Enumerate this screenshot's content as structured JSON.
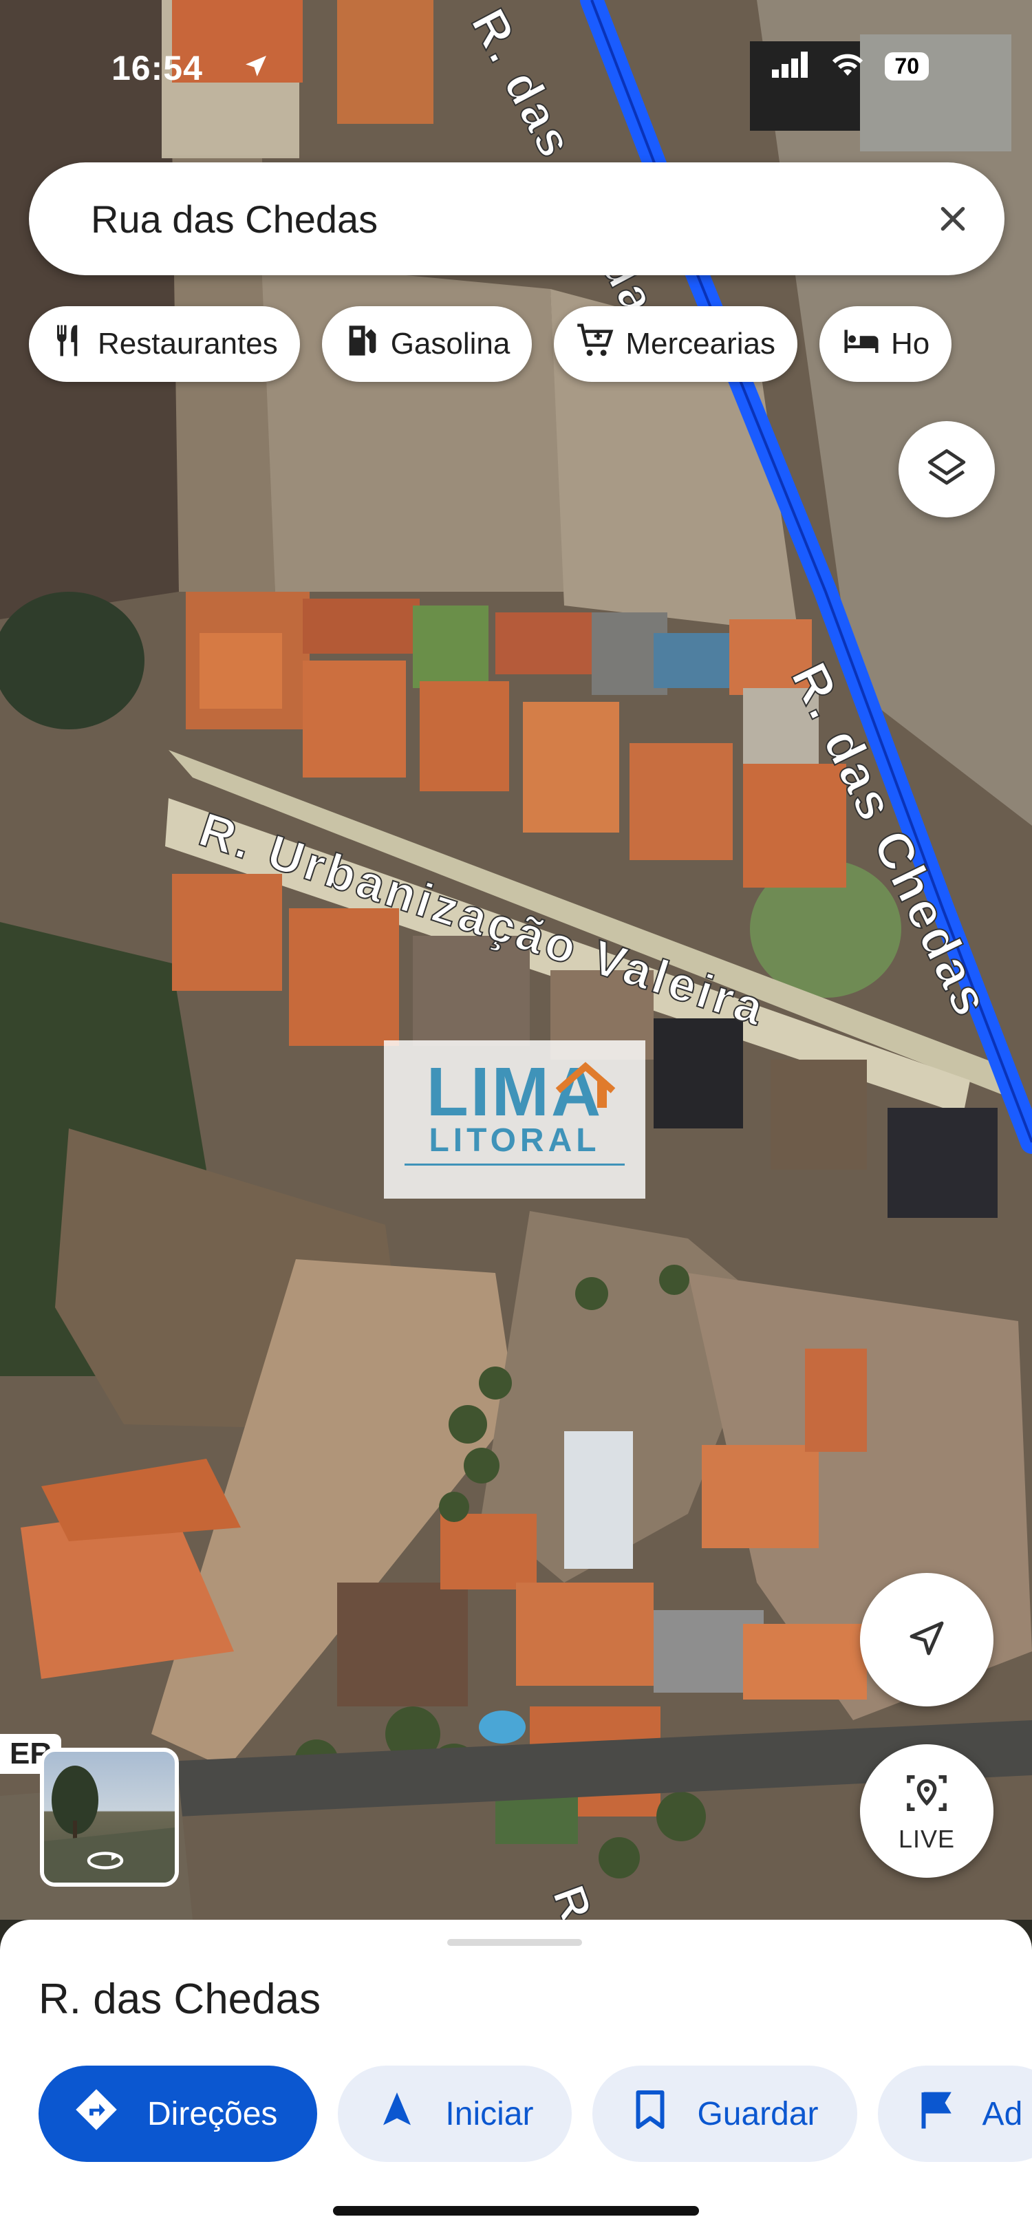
{
  "status_bar": {
    "time": "16:54",
    "battery": "70"
  },
  "search": {
    "value": "Rua das Chedas"
  },
  "chips": [
    {
      "label": "Restaurantes",
      "icon": "restaurant-icon"
    },
    {
      "label": "Gasolina",
      "icon": "gas-station-icon"
    },
    {
      "label": "Mercearias",
      "icon": "shopping-cart-icon"
    },
    {
      "label": "Ho",
      "icon": "hotel-icon"
    }
  ],
  "map": {
    "street_labels": [
      "R. das Chedas",
      "R. Urbanização Valeira"
    ],
    "partial_labels": [
      "ER",
      "R"
    ],
    "route_color": "#1a5cff"
  },
  "watermark": {
    "brand": "LIMA",
    "sub": "LITORAL"
  },
  "controls": {
    "live_label": "LIVE"
  },
  "sheet": {
    "title": "R. das Chedas",
    "actions": [
      {
        "label": "Direções",
        "icon": "directions-icon"
      },
      {
        "label": "Iniciar",
        "icon": "navigation-arrow-icon"
      },
      {
        "label": "Guardar",
        "icon": "bookmark-icon"
      },
      {
        "label": "Ad",
        "icon": "flag-icon"
      }
    ]
  },
  "colors": {
    "accent": "#0b57d0",
    "chip_bg": "#ffffff",
    "action_bg": "#e9eef8"
  }
}
